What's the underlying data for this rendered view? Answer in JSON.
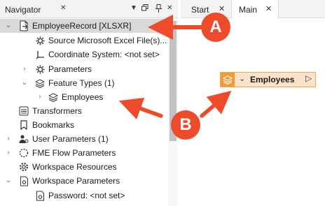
{
  "navigator": {
    "title": "Navigator",
    "header_icons": [
      "close-icon",
      "dropdown-icon",
      "restore-icon",
      "pin-icon",
      "close-panel-icon"
    ],
    "items": [
      {
        "label": "EmployeeRecord [XLSXR]",
        "icon": "reader-icon",
        "expanded": true,
        "selected": true
      },
      {
        "label": "Source Microsoft Excel File(s)...",
        "icon": "gear-icon"
      },
      {
        "label": "Coordinate System: <not set>",
        "icon": "coordinate-icon"
      },
      {
        "label": "Parameters",
        "icon": "gear-icon",
        "expanded": false
      },
      {
        "label": "Feature Types (1)",
        "icon": "layers-icon",
        "expanded": true
      },
      {
        "label": "Employees",
        "icon": "layers-icon",
        "expanded": false
      },
      {
        "label": "Transformers",
        "icon": "transformers-icon"
      },
      {
        "label": "Bookmarks",
        "icon": "bookmark-icon"
      },
      {
        "label": "User Parameters (1)",
        "icon": "user-params-icon",
        "expanded": false
      },
      {
        "label": "FME Flow Parameters",
        "icon": "flow-params-icon",
        "expanded": false
      },
      {
        "label": "Workspace Resources",
        "icon": "resources-icon"
      },
      {
        "label": "Workspace Parameters",
        "icon": "workspace-params-icon",
        "expanded": true
      },
      {
        "label": "Password: <not set>",
        "icon": "password-icon"
      }
    ]
  },
  "tabs": [
    {
      "label": "Start",
      "close": "✕"
    },
    {
      "label": "Main",
      "close": "✕",
      "active": true
    }
  ],
  "canvas": {
    "feature_type_node": {
      "label": "Employees",
      "color": "#f29a3a",
      "fill": "#fbe3c9"
    }
  },
  "annotations": {
    "color": "#ee4b2b",
    "callout_a": "A",
    "callout_b": "B"
  }
}
